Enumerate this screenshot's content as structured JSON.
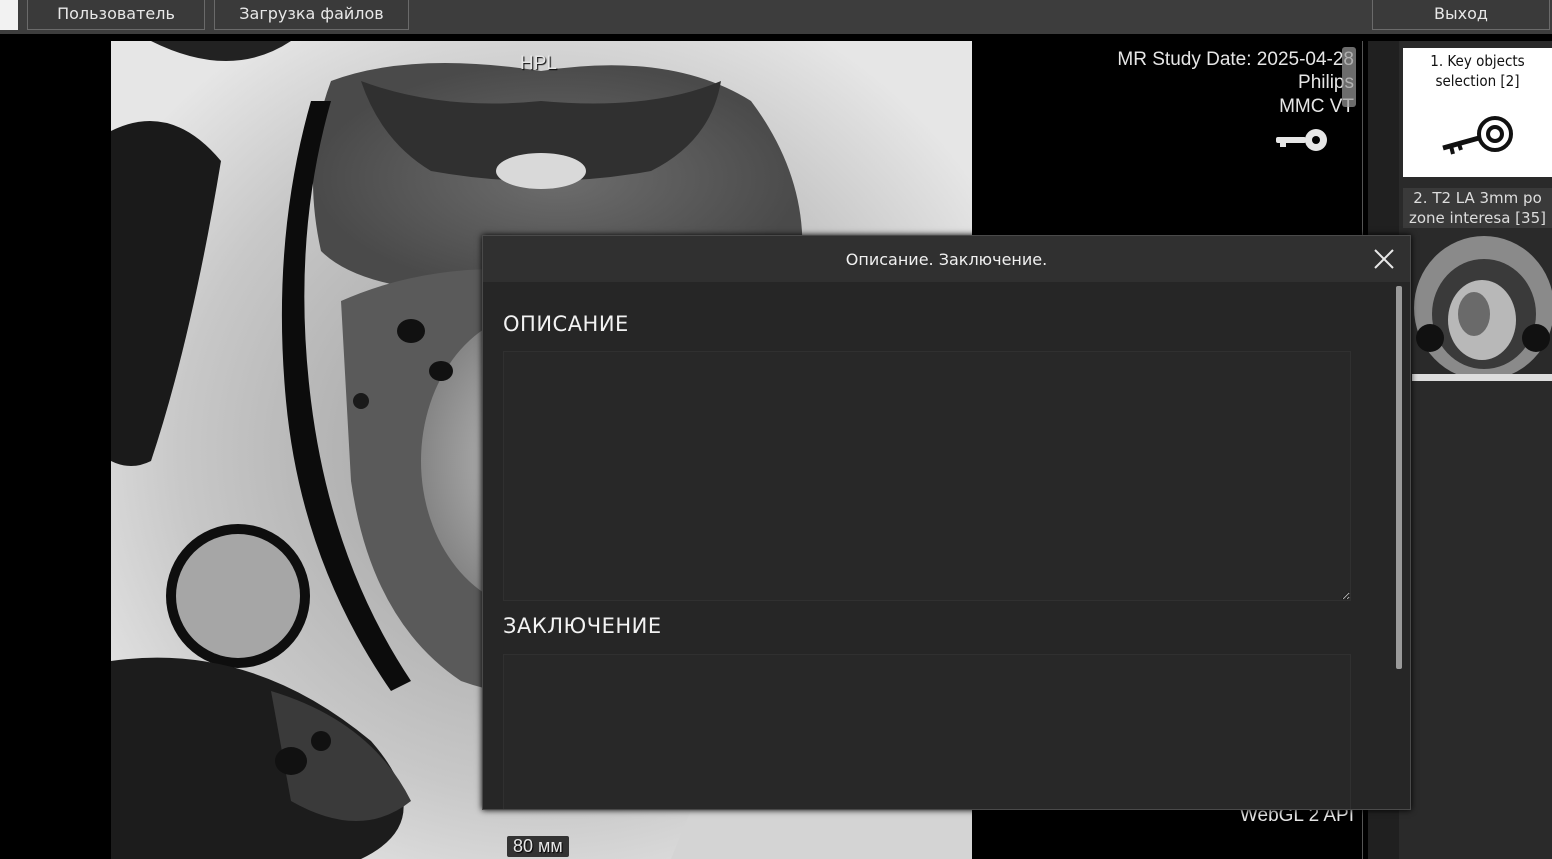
{
  "topbar": {
    "user_button": "Пользователь",
    "upload_button": "Загрузка файлов",
    "exit_button": "Выход"
  },
  "viewer": {
    "orientation": "HPL",
    "study_date": "MR Study Date: 2025-04-28",
    "manufacturer": "Philips",
    "model": "MMC VT",
    "renderer": "WebGL 2 API",
    "scale": "80 мм",
    "key_icon": "key-icon"
  },
  "series_panel": {
    "items": [
      {
        "label": "1. Key objects selection [2]",
        "icon": "key-icon"
      },
      {
        "label": "2. T2 LA 3mm po zone interesa [35]"
      }
    ]
  },
  "modal": {
    "title": "Описание. Заключение.",
    "close_icon": "close-icon",
    "description_heading": "ОПИСАНИЕ",
    "description_value": "",
    "conclusion_heading": "ЗАКЛЮЧЕНИЕ",
    "conclusion_value": ""
  }
}
